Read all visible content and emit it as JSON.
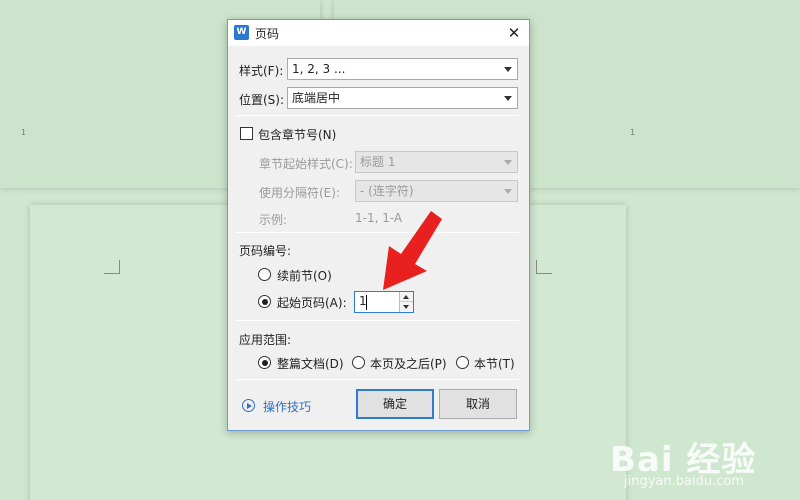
{
  "background": {
    "page_number_left": "1",
    "page_number_right": "1"
  },
  "dialog": {
    "app_icon": "W",
    "title": "页码",
    "style_label": "样式(F):",
    "style_value": "1, 2, 3 ...",
    "position_label": "位置(S):",
    "position_value": "底端居中",
    "include_chapter_label": "包含章节号(N)",
    "chapter_style_label": "章节起始样式(C):",
    "chapter_style_value": "标题 1",
    "separator_label": "使用分隔符(E):",
    "separator_value": "-    (连字符)",
    "example_label": "示例:",
    "example_value": "1-1, 1-A",
    "numbering_heading": "页码编号:",
    "continue_label": "续前节(O)",
    "start_at_label": "起始页码(A):",
    "start_at_value": "1",
    "apply_heading": "应用范围:",
    "apply_whole_label": "整篇文档(D)",
    "apply_forward_label": "本页及之后(P)",
    "apply_section_label": "本节(T)",
    "tips_label": "操作技巧",
    "ok_label": "确定",
    "cancel_label": "取消",
    "include_chapter_checked": false,
    "numbering_selected": "start_at",
    "apply_selected": "whole"
  },
  "watermark": {
    "logo": "Bai 经验",
    "url": "jingyan.baidu.com"
  },
  "colors": {
    "background": "#cfe6cf",
    "dialog_border": "#6b9bd1",
    "accent": "#2f7ad6",
    "annotation_arrow": "#e8201f"
  },
  "icons": [
    "word-app-icon",
    "close-icon",
    "dropdown-caret-icon",
    "play-circle-icon",
    "spinner-up-icon",
    "spinner-down-icon",
    "red-arrow-annotation"
  ]
}
